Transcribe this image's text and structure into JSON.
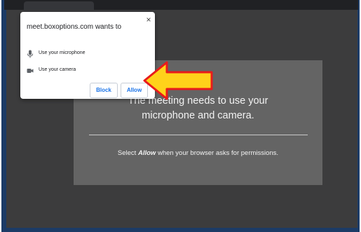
{
  "permission_dialog": {
    "title": "meet.boxoptions.com wants to",
    "close_symbol": "×",
    "permissions": [
      {
        "icon": "microphone-icon",
        "label": "Use your microphone"
      },
      {
        "icon": "camera-icon",
        "label": "Use your camera"
      }
    ],
    "block_label": "Block",
    "allow_label": "Allow"
  },
  "meeting": {
    "message": "The meeting needs to use your microphone and camera.",
    "instruction_before": "Select ",
    "instruction_emphasis": "Allow",
    "instruction_after": " when your browser asks for permissions."
  },
  "colors": {
    "accent_button_text": "#1a73e8",
    "callout_arrow_fill": "#ffd21a",
    "callout_arrow_outline": "#e81b1b"
  }
}
